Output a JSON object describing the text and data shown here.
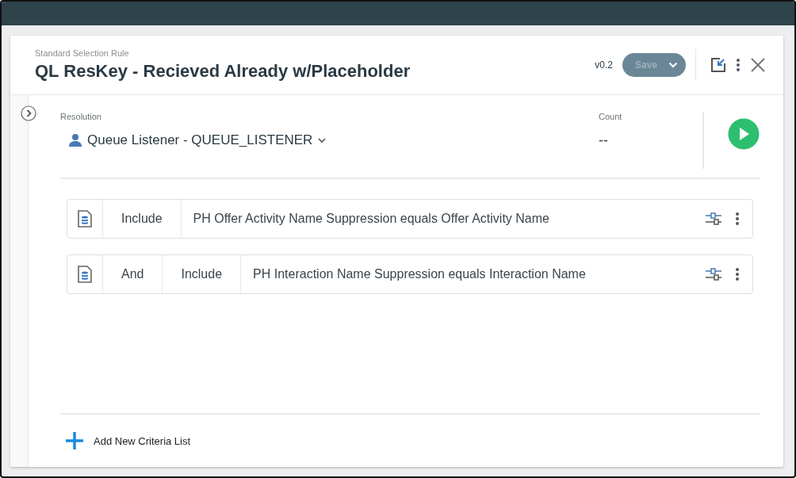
{
  "header": {
    "subtitle": "Standard Selection Rule",
    "title": "QL ResKey - Recieved Already w/Placeholder",
    "version": "v0.2",
    "save": {
      "label": "Save",
      "disabled": true
    }
  },
  "resolution": {
    "label": "Resolution",
    "value": "Queue Listener - QUEUE_LISTENER"
  },
  "count": {
    "label": "Count",
    "value": "--"
  },
  "criteria": [
    {
      "cells": [
        "Include",
        "PH Offer Activity Name Suppression equals Offer Activity Name"
      ]
    },
    {
      "cells": [
        "And",
        "Include",
        "PH Interaction Name Suppression equals Interaction Name"
      ]
    }
  ],
  "add_link": "Add New Criteria List"
}
